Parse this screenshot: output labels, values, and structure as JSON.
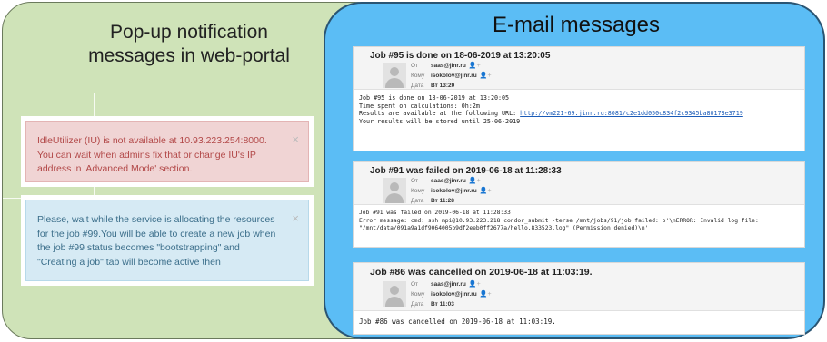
{
  "left_panel": {
    "title_line1": "Pop-up notification",
    "title_line2": "messages in web-portal",
    "notification_error": {
      "text": "IdleUtilizer (IU) is not available at 10.93.223.254:8000. You can wait when admins fix that or change IU's IP address in 'Advanced Mode' section.",
      "close": "×"
    },
    "notification_info": {
      "text": "Please, wait while the service is allocating the resources for the job #99.You will be able to create a new job when the job #99 status becomes \"bootstrapping\" and \"Creating a job\" tab will become active then",
      "close": "×"
    }
  },
  "right_panel": {
    "title": "E-mail messages",
    "labels": {
      "from": "От",
      "to": "Кому",
      "date": "Дата"
    },
    "plus_icon": "👤+",
    "emails": [
      {
        "subject": "Job #95 is done on 18-06-2019 at 13:20:05",
        "from": "saas@jinr.ru",
        "to": "isokolov@jinr.ru",
        "date": "Вт 13:20",
        "body_line1": "Job #95 is done on 18-06-2019 at 13:20:05",
        "body_line2": "Time spent on calculations: 0h:2m",
        "body_line3": "Results are available at the following URL: ",
        "body_link": "http://vm221-69.jinr.ru:8081/c2e1dd050c834f2c9345ba80173e3719",
        "body_line4": "Your results will be stored until 25-06-2019"
      },
      {
        "subject": "Job #91 was failed on 2019-06-18 at 11:28:33",
        "from": "saas@jinr.ru",
        "to": "isokolov@jinr.ru",
        "date": "Вт 11:28",
        "body_line1": "Job #91 was failed on 2019-06-18 at 11:28:33",
        "body_line2": "Error message: cmd: ssh mpi@10.93.223.218 condor_submit -terse /mnt/jobs/91/job failed: b'\\nERROR: Invalid log file:",
        "body_line3": "\"/mnt/data/091a9a1df9064005b9df2eeb0ff2677a/hello.833523.log\" (Permission denied)\\n'"
      },
      {
        "subject": "Job #86 was cancelled on 2019-06-18 at 11:03:19.",
        "from": "saas@jinr.ru",
        "to": "isokolov@jinr.ru",
        "date": "Вт 11:03",
        "body_line1": "Job #86 was cancelled on 2019-06-18 at 11:03:19."
      }
    ]
  },
  "colors": {
    "left_panel_bg": "#cfe3b8",
    "right_panel_bg": "#5bbdf5",
    "error_bg": "#f0d4d4",
    "error_text": "#b24848",
    "info_bg": "#d6eaf4",
    "info_text": "#3b6e8a",
    "link": "#1a5bb8"
  }
}
